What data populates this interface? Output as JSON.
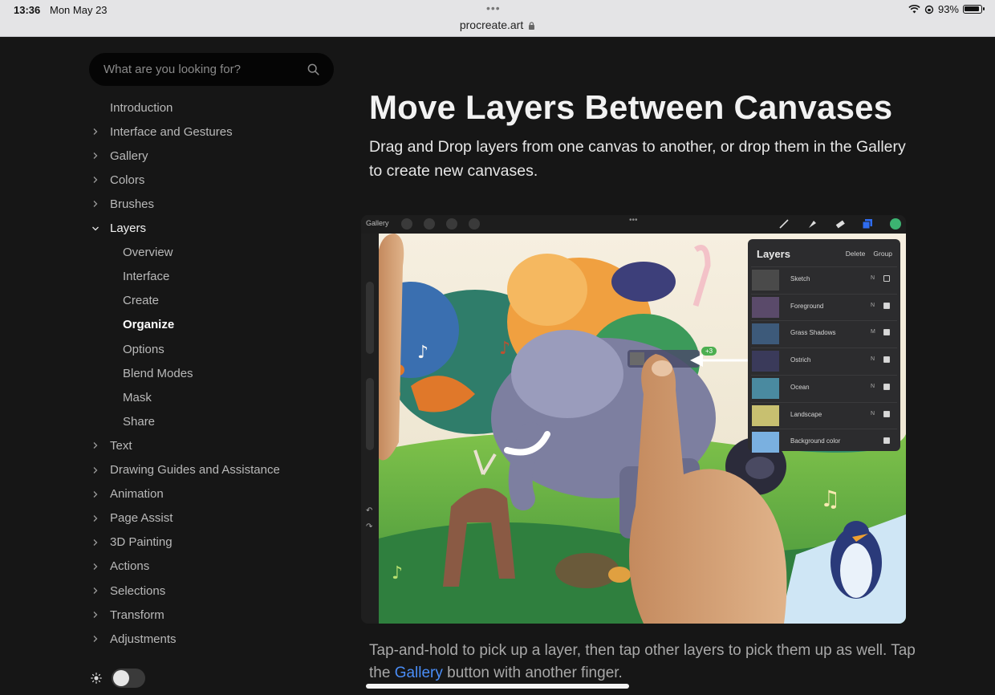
{
  "status_bar": {
    "time": "13:36",
    "date": "Mon May 23",
    "url": "procreate.art",
    "battery": "93%",
    "dots": "•••"
  },
  "search": {
    "placeholder": "What are you looking for?"
  },
  "sidebar": {
    "items": [
      {
        "label": "Introduction",
        "kind": "top"
      },
      {
        "label": "Interface and Gestures",
        "kind": "collapsed"
      },
      {
        "label": "Gallery",
        "kind": "collapsed"
      },
      {
        "label": "Colors",
        "kind": "collapsed"
      },
      {
        "label": "Brushes",
        "kind": "collapsed"
      },
      {
        "label": "Layers",
        "kind": "expanded"
      },
      {
        "label": "Overview",
        "kind": "sub"
      },
      {
        "label": "Interface",
        "kind": "sub"
      },
      {
        "label": "Create",
        "kind": "sub"
      },
      {
        "label": "Organize",
        "kind": "sub-active"
      },
      {
        "label": "Options",
        "kind": "sub"
      },
      {
        "label": "Blend Modes",
        "kind": "sub"
      },
      {
        "label": "Mask",
        "kind": "sub"
      },
      {
        "label": "Share",
        "kind": "sub"
      },
      {
        "label": "Text",
        "kind": "collapsed"
      },
      {
        "label": "Drawing Guides and Assistance",
        "kind": "collapsed"
      },
      {
        "label": "Animation",
        "kind": "collapsed"
      },
      {
        "label": "Page Assist",
        "kind": "collapsed"
      },
      {
        "label": "3D Painting",
        "kind": "collapsed"
      },
      {
        "label": "Actions",
        "kind": "collapsed"
      },
      {
        "label": "Selections",
        "kind": "collapsed"
      },
      {
        "label": "Transform",
        "kind": "collapsed"
      },
      {
        "label": "Adjustments",
        "kind": "collapsed"
      }
    ]
  },
  "main": {
    "title": "Move Layers Between Canvases",
    "subtitle": "Drag and Drop layers from one canvas to another, or drop them in the Gallery to create new canvases.",
    "caption_before": "Tap-and-hold to pick up a layer, then tap other layers to pick them up as well. Tap the ",
    "caption_link": "Gallery",
    "caption_after": " button with another finger."
  },
  "figure": {
    "gallery_button": "Gallery",
    "layers_panel": {
      "title": "Layers",
      "delete": "Delete",
      "group": "Group",
      "rows": [
        {
          "name": "Sketch",
          "mode": "N",
          "visible": false,
          "thumb": "#4a4a4a"
        },
        {
          "name": "Foreground",
          "mode": "N",
          "visible": true,
          "thumb": "#5a4a6a"
        },
        {
          "name": "Grass Shadows",
          "mode": "M",
          "visible": true,
          "thumb": "#3d5a7a"
        },
        {
          "name": "Ostrich",
          "mode": "N",
          "visible": true,
          "thumb": "#3a3a5a"
        },
        {
          "name": "Ocean",
          "mode": "N",
          "visible": true,
          "thumb": "#4a8aa0"
        },
        {
          "name": "Landscape",
          "mode": "N",
          "visible": true,
          "thumb": "#c8c070"
        },
        {
          "name": "Background color",
          "mode": "",
          "visible": true,
          "thumb": "#7ab0e0"
        }
      ]
    },
    "drag_badge": "+3"
  },
  "colors": {
    "link": "#4a8df6",
    "background": "#161616",
    "accent_green": "#3cb371"
  }
}
